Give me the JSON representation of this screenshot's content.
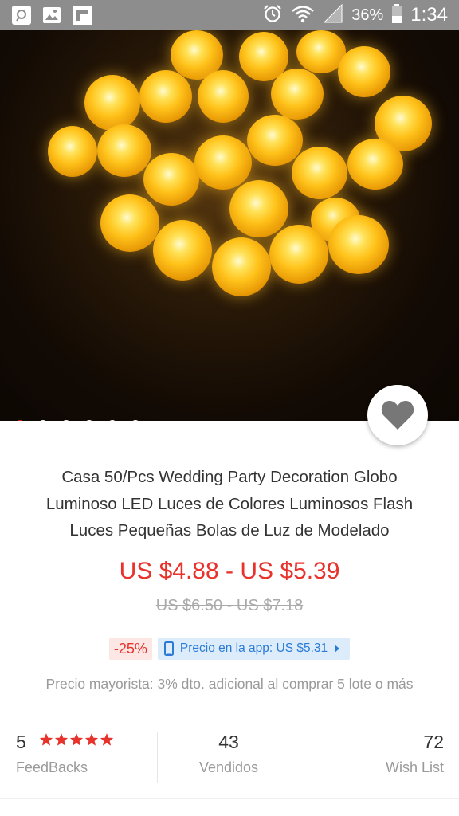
{
  "status_bar": {
    "battery": "36%",
    "time": "1:34",
    "left_icons": [
      "search-app-icon",
      "gallery-icon",
      "flipboard-icon"
    ],
    "right_icons": [
      "alarm-icon",
      "wifi-icon",
      "signal-icon",
      "battery-icon"
    ]
  },
  "carousel": {
    "image_count": 6,
    "active_index": 0
  },
  "product": {
    "title_line1": "Casa 50/Pcs Wedding Party Decoration Globo",
    "title_line2": "Luminoso LED Luces de Colores Luminosos Flash",
    "title_line3": "Luces Pequeñas Bolas de Luz de Modelado",
    "price": "US $4.88 - US $5.39",
    "original_price": "US $6.50 - US $7.18",
    "discount": "-25%",
    "app_price": "Precio en la app: US $5.31",
    "wholesale": "Precio mayorista: 3% dto. adicional al comprar 5 lote o más"
  },
  "stats": {
    "feedback_count": "5",
    "feedback_label": "FeedBacks",
    "rating_stars": 5,
    "sold_count": "43",
    "sold_label": "Vendidos",
    "wishlist_count": "72",
    "wishlist_label": "Wish List"
  },
  "colors": {
    "accent": "#e8322c",
    "app_price_blue": "#2b7bd6",
    "status_bar": "#8d8d8d"
  }
}
